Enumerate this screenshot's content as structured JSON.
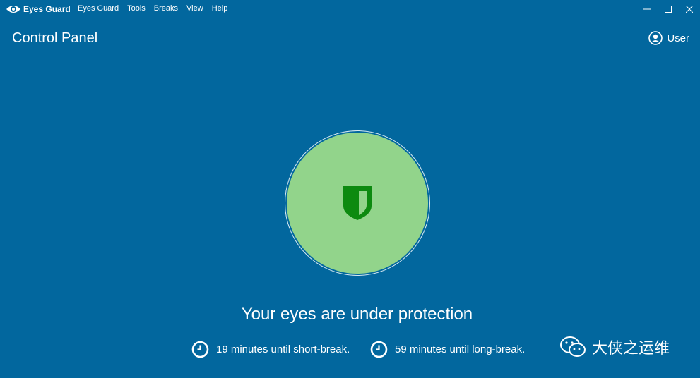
{
  "app": {
    "name": "Eyes Guard"
  },
  "menu": {
    "items": [
      "Eyes Guard",
      "Tools",
      "Breaks",
      "View",
      "Help"
    ]
  },
  "header": {
    "title": "Control Panel",
    "user_label": "User"
  },
  "status": {
    "message": "Your eyes are under protection"
  },
  "timers": {
    "short_break": "19 minutes until short-break.",
    "long_break": "59 minutes until long-break."
  },
  "watermark": {
    "text": "大侠之运维"
  },
  "colors": {
    "background": "#02679e",
    "circle_fill": "#92d48b",
    "shield": "#0d8a10",
    "text": "#ffffff"
  },
  "icons": [
    "eye-logo-icon",
    "minimize-icon",
    "maximize-icon",
    "close-icon",
    "user-icon",
    "shield-icon",
    "clock-icon",
    "wechat-icon"
  ]
}
